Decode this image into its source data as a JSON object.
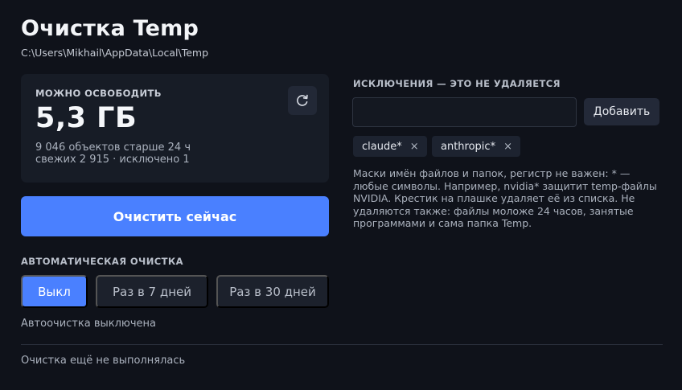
{
  "header": {
    "title": "Очистка Temp",
    "path": "C:\\Users\\Mikhail\\AppData\\Local\\Temp"
  },
  "summary": {
    "label": "МОЖНО ОСВОБОДИТЬ",
    "size": "5,3 ГБ",
    "line1": "9 046 объектов старше 24 ч",
    "line2": "свежих 2 915 · исключено 1",
    "refresh_icon": "refresh-icon"
  },
  "actions": {
    "clean_label": "Очистить сейчас"
  },
  "auto_clean": {
    "label": "АВТОМАТИЧЕСКАЯ ОЧИСТКА",
    "options": [
      "Выкл",
      "Раз в 7 дней",
      "Раз в 30 дней"
    ],
    "selected": "Выкл",
    "status": "Автоочистка выключена"
  },
  "footer": {
    "last_run": "Очистка ещё не выполнялась"
  },
  "exclusions": {
    "label": "ИСКЛЮЧЕНИЯ — ЭТО НЕ УДАЛЯЕТСЯ",
    "input_value": "",
    "add_label": "Добавить",
    "tags": [
      "claude*",
      "anthropic*"
    ],
    "remove_glyph": "×",
    "help": "Маски имён файлов и папок, регистр не важен: * — любые символы. Например, nvidia* защитит temp-файлы NVIDIA. Крестик на плашке удаляет её из списка. Не удаляются также: файлы моложе 24 часов, занятые программами и сама папка Temp."
  },
  "colors": {
    "background": "#0f121a",
    "card": "#171c26",
    "accent": "#4a80ff",
    "muted_button": "#1c212c"
  }
}
